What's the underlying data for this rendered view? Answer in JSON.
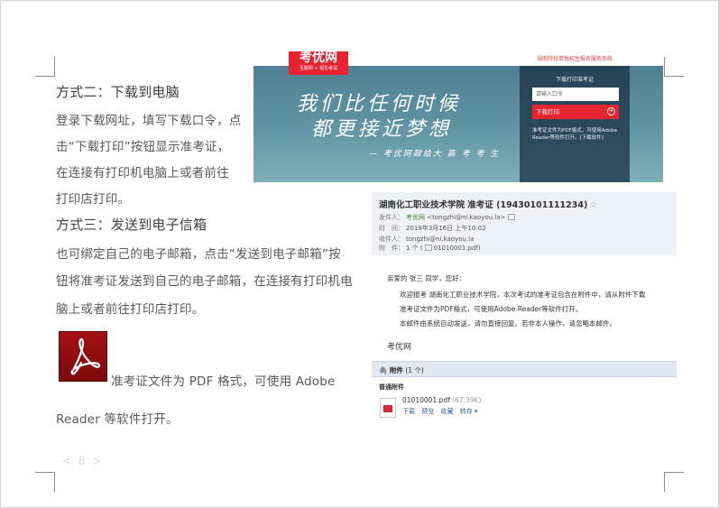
{
  "left_text": {
    "method2_heading": "方式二：下载到电脑",
    "method2_lines": [
      "登录下载网址，填写下载口令，点",
      "击“下载打印”按钮显示准考证，",
      "在连接有打印机电脑上或者前往",
      "打印店打印。"
    ],
    "method3_heading": "方式三：发送到电子信箱",
    "method3_lines": [
      "也可绑定自己的电子邮箱，点击“发送到电子邮箱”按",
      "钮将准考证发送到自己的电子邮箱，在连接有打印机电",
      "脑上或者前往打印店打印。"
    ],
    "pdf_note_line1": "准考证文件为 PDF 格式，可使用 Adobe",
    "pdf_note_line2": "Reader 等软件打开。",
    "pdf_icon": "adobe-pdf-icon"
  },
  "page_number": "< 8 >",
  "banner": {
    "logo_main": "考优网",
    "logo_sub": "互联网 + 招生考试",
    "top_link": "湖南院校单独招生报名服务系统",
    "slogan_line1": "我们比任何时候",
    "slogan_line2": "都更接近梦想",
    "slogan_line3": "— 考优网献给大 高 考 考 生",
    "panel_title": "下载打印准考证",
    "input_placeholder": "请输入口令",
    "download_button": "下载打印",
    "panel_note": "准考证文件为PDF格式，可使用Adobe Reader等软件打开。[下载软件]"
  },
  "email": {
    "subject": "湖南化工职业技术学院 准考证 (19430101111234)",
    "sender_label": "发件人：",
    "sender_name": "考优网",
    "sender_addr": "<tongzhi@ni.kaoyou.la>",
    "time_label": "时　间：",
    "time_value": "2019年3月16日 上午10:02",
    "recipient_label": "收件人：",
    "recipient_value": "tongzhi@ni.kaoyou.la",
    "attachment_label": "附　件：",
    "attachment_value": "1 个 (",
    "attachment_file": "01010001.pdf",
    "attachment_close": ")",
    "greeting": "亲爱的 张三 同学，您好：",
    "body_lines": [
      "欢迎报考  湖南化工职业技术学院，本次考试的准考证包含在附件中，请从附件下载",
      "准考证文件为PDF格式，可使用Adobe Reader等软件打开。",
      "本邮件由系统自动发送，请勿直接回复。若非本人操作，请忽略本邮件。"
    ],
    "signature": "考优网",
    "attachments_bar": "附件",
    "attachments_count": "(1 个)",
    "attachment_type": "普通附件",
    "file_name": "01010001.pdf",
    "file_size": "(67.39K)",
    "actions": [
      "下载",
      "预览",
      "收藏",
      "转存 ▾"
    ]
  },
  "colors": {
    "brand_red": "#e9222f",
    "link_green": "#3a8f2f",
    "link_blue": "#2f62a7"
  }
}
